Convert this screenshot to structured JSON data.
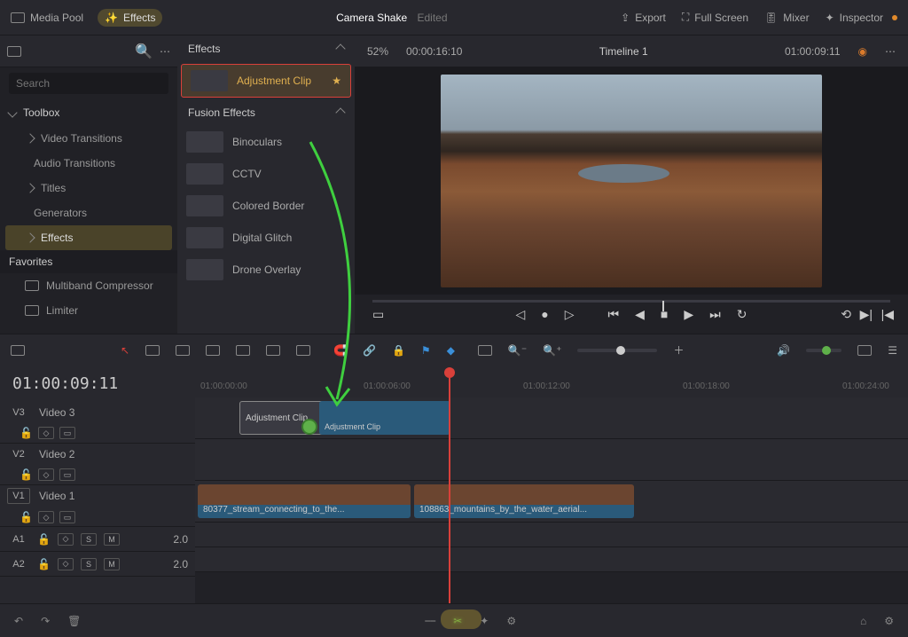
{
  "top": {
    "media_pool": "Media Pool",
    "effects": "Effects",
    "title": "Camera Shake",
    "status": "Edited",
    "export": "Export",
    "fullscreen": "Full Screen",
    "mixer": "Mixer",
    "inspector": "Inspector"
  },
  "viewer": {
    "zoom": "52%",
    "src_tc": "00:00:16:10",
    "timeline_name": "Timeline 1",
    "tl_tc": "01:00:09:11"
  },
  "search": {
    "placeholder": "Search"
  },
  "toolbox": {
    "header": "Toolbox",
    "items": [
      "Video Transitions",
      "Audio Transitions",
      "Titles",
      "Generators",
      "Effects"
    ]
  },
  "favorites": {
    "header": "Favorites",
    "items": [
      "Multiband Compressor",
      "Limiter"
    ]
  },
  "panel": {
    "effects_header": "Effects",
    "adjustment_clip": "Adjustment Clip",
    "fusion_header": "Fusion Effects",
    "fusion_items": [
      "Binoculars",
      "CCTV",
      "Colored Border",
      "Digital Glitch",
      "Drone Overlay"
    ]
  },
  "timeline": {
    "tc": "01:00:09:11",
    "ruler": [
      "01:00:00:00",
      "01:00:06:00",
      "01:00:12:00",
      "01:00:18:00",
      "01:00:24:00"
    ],
    "tracks": {
      "v3": {
        "id": "V3",
        "name": "Video 3"
      },
      "v2": {
        "id": "V2",
        "name": "Video 2"
      },
      "v1": {
        "id": "V1",
        "name": "Video 1"
      },
      "a1": {
        "id": "A1",
        "level": "2.0"
      },
      "a2": {
        "id": "A2",
        "level": "2.0"
      }
    },
    "adj_drop": "Adjustment Clip",
    "adj_exist": "Adjustment Clip",
    "clip_a": "80377_stream_connecting_to_the...",
    "clip_b": "108863_mountains_by_the_water_aerial...",
    "sm_btn": {
      "s": "S",
      "m": "M"
    }
  }
}
